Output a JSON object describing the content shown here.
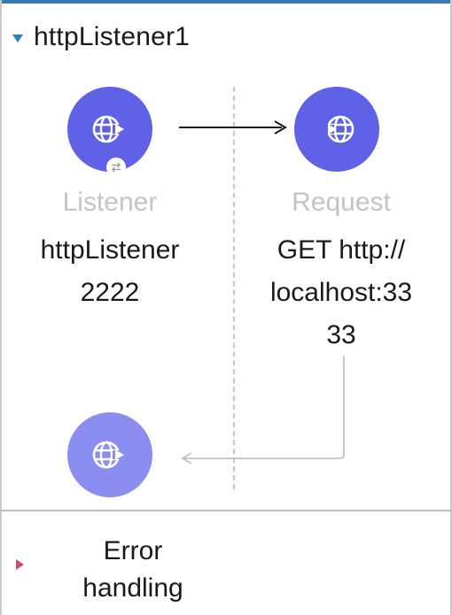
{
  "flow": {
    "title": "httpListener1"
  },
  "nodes": {
    "listener": {
      "type_label": "Listener",
      "detail_line1": "httpListener",
      "detail_line2": "2222",
      "icon": "globe-inbound-icon"
    },
    "request": {
      "type_label": "Request",
      "detail_line1": "GET http://",
      "detail_line2": "localhost:33",
      "detail_line3": "33",
      "icon": "globe-outbound-icon"
    },
    "response": {
      "icon": "globe-inbound-icon"
    }
  },
  "error_handling": {
    "label_line1": "Error",
    "label_line2": "handling"
  },
  "colors": {
    "accent": "#5f62e6",
    "accent_light": "#8b8ef0",
    "expand_arrow": "#2a7fc1",
    "collapse_arrow": "#d14a6e",
    "type_label": "#c4c4c4"
  }
}
